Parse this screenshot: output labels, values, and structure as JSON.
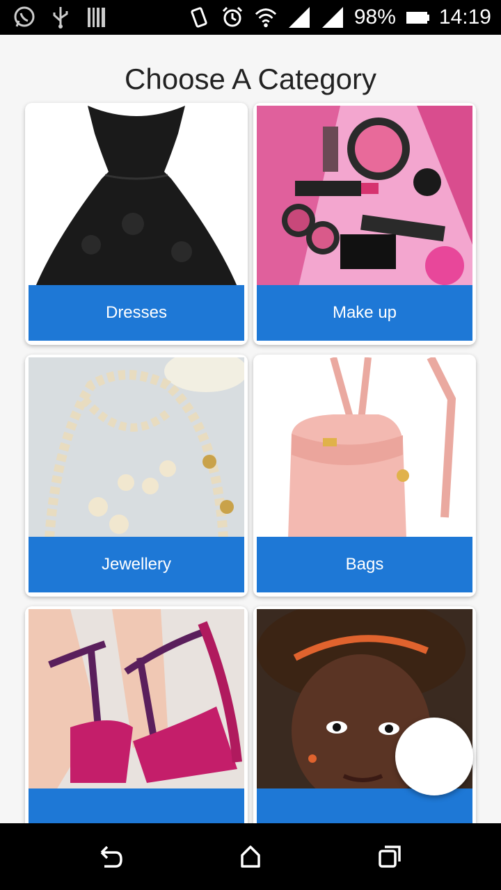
{
  "status_bar": {
    "battery_text": "98%",
    "time": "14:19",
    "left_icons": [
      "whatsapp-icon",
      "usb-icon",
      "barcode-icon"
    ],
    "right_icons": [
      "vibrate-icon",
      "alarm-icon",
      "wifi-icon",
      "signal-icon",
      "signal-icon-2",
      "battery-icon"
    ]
  },
  "page": {
    "title": "Choose A Category"
  },
  "categories": [
    {
      "label": "Dresses",
      "image": "black-lace-dress-image"
    },
    {
      "label": "Make up",
      "image": "makeup-products-image"
    },
    {
      "label": "Jewellery",
      "image": "pearl-jewellery-image"
    },
    {
      "label": "Bags",
      "image": "pink-backpack-image"
    },
    {
      "label": "",
      "image": "pink-heels-image"
    },
    {
      "label": "",
      "image": "hair-accessory-image"
    }
  ],
  "colors": {
    "accent": "#1E78D6",
    "background": "#F6F6F6"
  },
  "nav_bar": {
    "icons": [
      "back-icon",
      "home-icon",
      "recents-icon"
    ]
  }
}
